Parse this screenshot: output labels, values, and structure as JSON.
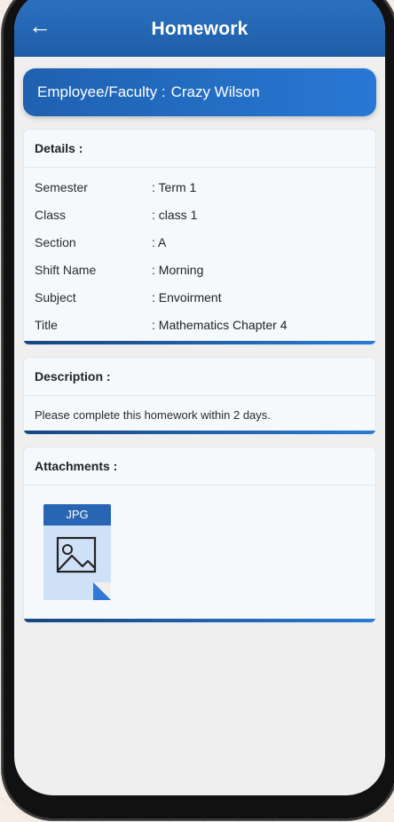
{
  "header": {
    "title": "Homework"
  },
  "faculty": {
    "label": "Employee/Faculty :",
    "name": "Crazy  Wilson"
  },
  "details": {
    "heading": "Details :",
    "rows": [
      {
        "key": "Semester",
        "value": ":  Term 1"
      },
      {
        "key": "Class",
        "value": ": class 1"
      },
      {
        "key": "Section",
        "value": ": A"
      },
      {
        "key": "Shift Name",
        "value": ": Morning"
      },
      {
        "key": "Subject",
        "value": ": Envoirment"
      },
      {
        "key": "Title",
        "value": ": Mathematics Chapter 4"
      }
    ]
  },
  "description": {
    "heading": "Description :",
    "text": "Please complete this homework within 2 days."
  },
  "attachments": {
    "heading": "Attachments :",
    "file_type": "JPG",
    "file_icon": "image-icon"
  },
  "colors": {
    "appbar": "#2d73c4",
    "accent": "#1e5ea8",
    "file_light": "#cfe1f7"
  }
}
